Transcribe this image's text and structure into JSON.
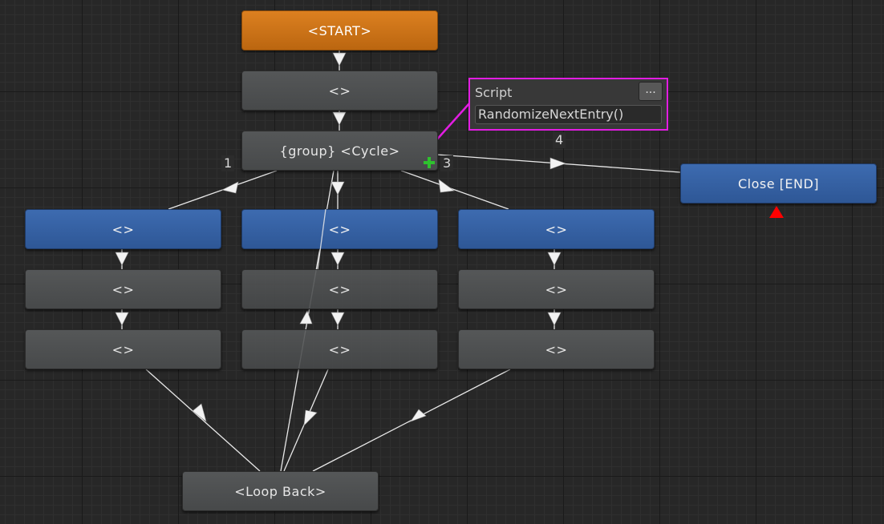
{
  "nodes": {
    "start": "<START>",
    "n1": "<>",
    "cycle": "{group} <Cycle>",
    "close": "Close [END]",
    "a1": "<>",
    "a2": "<>",
    "a3": "<>",
    "b1": "<>",
    "b2": "<>",
    "b3": "<>",
    "c1": "<>",
    "c2": "<>",
    "c3": "<>",
    "loop": "<Loop Back>"
  },
  "edge_labels": {
    "l1": "1",
    "l3": "3",
    "l4": "4"
  },
  "script_panel": {
    "title": "Script",
    "more_button": "...",
    "value": "RandomizeNextEntry()"
  },
  "colors": {
    "start_node": "#dc8020",
    "entry_node": "#3d6bb0",
    "default_node": "#505253",
    "highlight": "#e21de2",
    "add_icon": "#2ec12e",
    "end_marker": "#ff0000",
    "edge": "#e8e8e8"
  },
  "icons": {
    "add": "plus-icon",
    "end": "end-triangle-icon"
  }
}
